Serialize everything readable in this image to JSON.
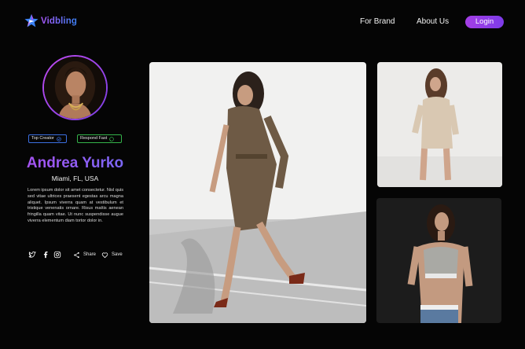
{
  "header": {
    "logo_text": "Vidbling",
    "nav": {
      "for_brand": "For Brand",
      "about_us": "About Us"
    },
    "login_label": "Login"
  },
  "profile": {
    "badges": {
      "top_creator": "Top Creator",
      "respond_fast": "Respond Fast"
    },
    "name": "Andrea Yurko",
    "location": "Miami, FL, USA",
    "bio": "Lorem ipsum dolor sit amet consectetur. Nisl quis sed vitae ultrices praesent egestas arcu magna aliquet. Ipsum viverra quam at vestibulum et tristique venenatis ornare. Risus mattis aenean fringilla quam vitae. Ut nunc suspendisse augue viverra elementum diam tortor dolor in.",
    "actions": {
      "share": "Share",
      "save": "Save"
    }
  },
  "colors": {
    "accent": "#a855f7",
    "brand_gradient_end": "#3b82f6",
    "background": "#050505",
    "badge_blue": "#3b6fe0",
    "badge_green": "#34b34a"
  },
  "icons": [
    "logo-star-icon",
    "check-circle-icon",
    "chat-icon",
    "twitter-icon",
    "facebook-icon",
    "instagram-icon",
    "share-icon",
    "heart-icon"
  ]
}
